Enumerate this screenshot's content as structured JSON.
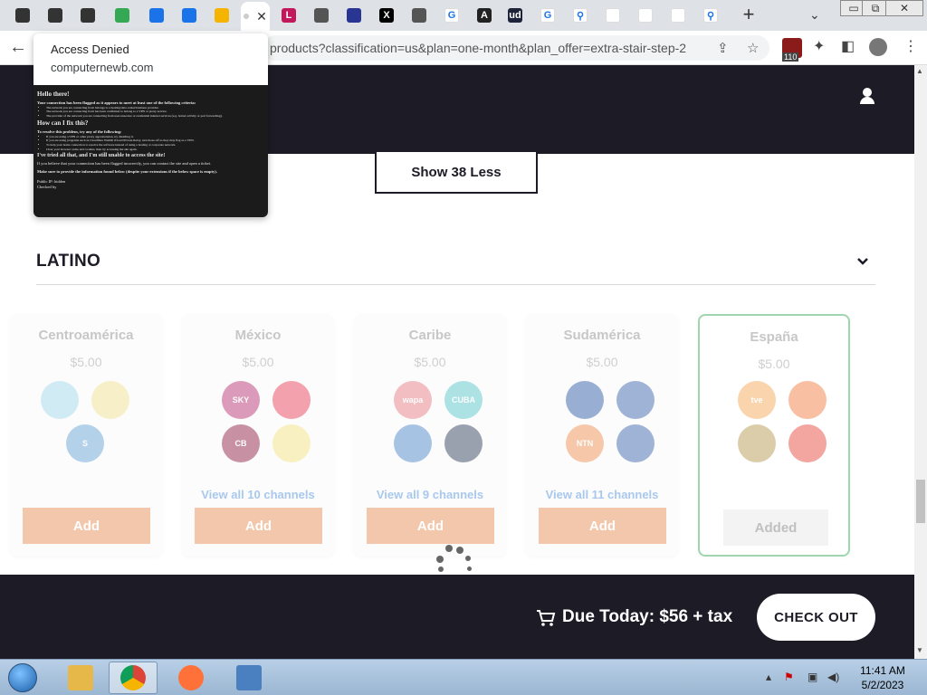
{
  "browser": {
    "tabs": [
      {
        "icon": "github-icon",
        "color": "#333333",
        "glyph": ""
      },
      {
        "icon": "github-icon",
        "color": "#333333",
        "glyph": ""
      },
      {
        "icon": "github-icon",
        "color": "#333333",
        "glyph": ""
      },
      {
        "icon": "maps-icon",
        "color": "#34a853",
        "glyph": ""
      },
      {
        "icon": "play-store-icon",
        "color": "#1a73e8",
        "glyph": ""
      },
      {
        "icon": "play-store-icon",
        "color": "#1a73e8",
        "glyph": ""
      },
      {
        "icon": "account-icon",
        "color": "#f4b400",
        "glyph": ""
      },
      {
        "icon": "loading-tab-icon",
        "color": "#cccccc",
        "glyph": "",
        "active": true
      },
      {
        "icon": "letter-l-icon",
        "color": "#c2185b",
        "glyph": "L"
      },
      {
        "icon": "globe-icon",
        "color": "#555555",
        "glyph": ""
      },
      {
        "icon": "grid-icon",
        "color": "#283593",
        "glyph": ""
      },
      {
        "icon": "x-icon",
        "color": "#000000",
        "glyph": "X"
      },
      {
        "icon": "globe-icon",
        "color": "#555555",
        "glyph": ""
      },
      {
        "icon": "google-icon",
        "color": "#ffffff",
        "glyph": "G"
      },
      {
        "icon": "letter-a-icon",
        "color": "#222222",
        "glyph": "A"
      },
      {
        "icon": "urban-dictionary-icon",
        "color": "#1d2439",
        "glyph": "ud"
      },
      {
        "icon": "google-icon",
        "color": "#ffffff",
        "glyph": "G"
      },
      {
        "icon": "search-icon",
        "color": "#ffffff",
        "glyph": "⚲"
      },
      {
        "icon": "microsoft-icon",
        "color": "#ffffff",
        "glyph": ""
      },
      {
        "icon": "chart-icon",
        "color": "#ffffff",
        "glyph": ""
      },
      {
        "icon": "badge-icon",
        "color": "#ffffff",
        "glyph": ""
      },
      {
        "icon": "search-icon",
        "color": "#ffffff",
        "glyph": "⚲"
      }
    ],
    "url": "products?classification=us&plan=one-month&plan_offer=extra-stair-step-2",
    "extension_badge": "110",
    "new_tab": "+",
    "close_tab": "✕",
    "back": "←",
    "win_min": "▭",
    "win_max": "⧉",
    "win_close": "✕"
  },
  "hovercard": {
    "title": "Access Denied",
    "domain": "computernewb.com",
    "preview": {
      "h1": "Hello there!",
      "p1": "Your connection has been flagged as it appears to meet at least one of the following criteria:",
      "b1": "The network you are connecting from belongs to a hosting/data center/business provider.",
      "b2": "The network you are connecting from has been confirmed to belong to a VPN or proxy service.",
      "b3": "The provider of the network you are connecting from uses unsecure or residential internet services (e.g. botnet activity or port forwarding).",
      "h2": "How can I fix this?",
      "p2": "To resolve this problem, try any of the following:",
      "b4": "If you are using a VPN or other proxy app/extension, try disabling it.",
      "b5": "If you are using programs such as Cloudflare WARP, iCloud Private Relay, turn those off as they may flag as a VPN.",
      "b6": "To help your home connection to resolve the software instead of using a hosting or corporate network.",
      "b7": "Clear your browser cache and cookies, then try accessing the site again.",
      "h3": "I've tried all that, and I'm still unable to access the site!",
      "p3": "If you believe that your connection has been flagged incorrectly, you can contact the site and open a ticket.",
      "p4": "Make sure to provide the information found below (despite your extensions if the below space is empty).",
      "p5": "Public IP: hidden",
      "p6": "Checked by"
    }
  },
  "page": {
    "show_less": "Show 38 Less",
    "section_title": "LATINO",
    "cards": [
      {
        "title": "Centroamérica",
        "price": "$5.00",
        "view_all": "",
        "button": "Add",
        "added": false,
        "logos": [
          {
            "name": "canal-logo-1",
            "color": "#9ed6ea",
            "text": ""
          },
          {
            "name": "canal-logo-2",
            "color": "#f2e08a",
            "text": ""
          },
          {
            "name": "canal-logo-3",
            "color": "#5f9ed6",
            "text": "S"
          }
        ]
      },
      {
        "title": "México",
        "price": "$5.00",
        "view_all": "View all 10 channels",
        "button": "Add",
        "added": false,
        "logos": [
          {
            "name": "canal-logo-4",
            "color": "#b5256a",
            "text": "SKY"
          },
          {
            "name": "canal-logo-5",
            "color": "#e8344c",
            "text": ""
          },
          {
            "name": "canal-logo-6",
            "color": "#8a1239",
            "text": "CB"
          },
          {
            "name": "canal-logo-7",
            "color": "#f4e27a",
            "text": ""
          }
        ]
      },
      {
        "title": "Caribe",
        "price": "$5.00",
        "view_all": "View all 9 channels",
        "button": "Add",
        "added": false,
        "logos": [
          {
            "name": "canal-logo-8",
            "color": "#e8757a",
            "text": "wapa"
          },
          {
            "name": "canal-logo-9",
            "color": "#4fc3c9",
            "text": "CUBA"
          },
          {
            "name": "canal-logo-10",
            "color": "#3d7ec7",
            "text": ""
          },
          {
            "name": "canal-logo-11",
            "color": "#23324f",
            "text": ""
          }
        ]
      },
      {
        "title": "Sudamérica",
        "price": "$5.00",
        "view_all": "View all 11 channels",
        "button": "Add",
        "added": false,
        "logos": [
          {
            "name": "canal-logo-12",
            "color": "#1f4fa0",
            "text": ""
          },
          {
            "name": "canal-logo-13",
            "color": "#2c5aa8",
            "text": ""
          },
          {
            "name": "canal-logo-14",
            "color": "#f08a47",
            "text": "NTN"
          },
          {
            "name": "canal-logo-15",
            "color": "#2c5aa8",
            "text": ""
          }
        ]
      },
      {
        "title": "España",
        "price": "$5.00",
        "view_all": "",
        "button": "Added",
        "added": true,
        "logos": [
          {
            "name": "tve-logo",
            "color": "#f2a24a",
            "text": "tve"
          },
          {
            "name": "antena3-logo",
            "color": "#f07030",
            "text": ""
          },
          {
            "name": "canal-logo-16",
            "color": "#b09040",
            "text": ""
          },
          {
            "name": "canal-logo-17",
            "color": "#e23a2a",
            "text": ""
          }
        ]
      }
    ],
    "due_today": "Due Today: $56 + tax",
    "checkout": "CHECK OUT"
  },
  "taskbar": {
    "time": "11:41 AM",
    "date": "5/2/2023",
    "apps": [
      {
        "icon": "file-explorer-icon",
        "color": "#e6b84a"
      },
      {
        "icon": "chrome-icon",
        "color": "#db4437",
        "active": true
      },
      {
        "icon": "firefox-icon",
        "color": "#ff7139"
      },
      {
        "icon": "control-panel-icon",
        "color": "#4a7fc0"
      }
    ]
  }
}
